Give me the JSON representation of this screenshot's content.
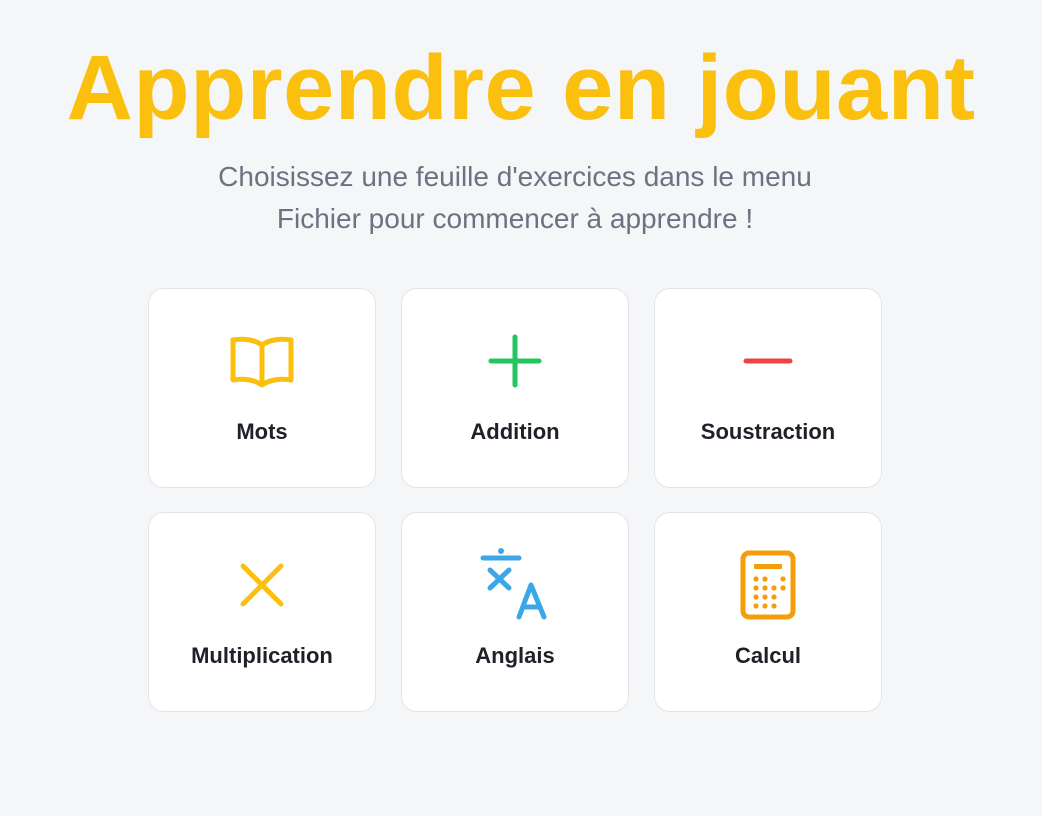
{
  "header": {
    "title": "Apprendre en jouant",
    "title_color": "#fbbf0e",
    "subtitle_line1": "Choisissez une feuille d'exercices dans le menu",
    "subtitle_line2": "Fichier pour commencer à apprendre !"
  },
  "cards": [
    {
      "label": "Mots",
      "icon": "book-icon",
      "color": "#fbbf0e"
    },
    {
      "label": "Addition",
      "icon": "plus-icon",
      "color": "#22c55e"
    },
    {
      "label": "Soustraction",
      "icon": "minus-icon",
      "color": "#ef4444"
    },
    {
      "label": "Multiplication",
      "icon": "times-icon",
      "color": "#fbbf0e"
    },
    {
      "label": "Anglais",
      "icon": "translate-icon",
      "color": "#3ba7e8"
    },
    {
      "label": "Calcul",
      "icon": "calculator-icon",
      "color": "#f59e0b"
    }
  ]
}
